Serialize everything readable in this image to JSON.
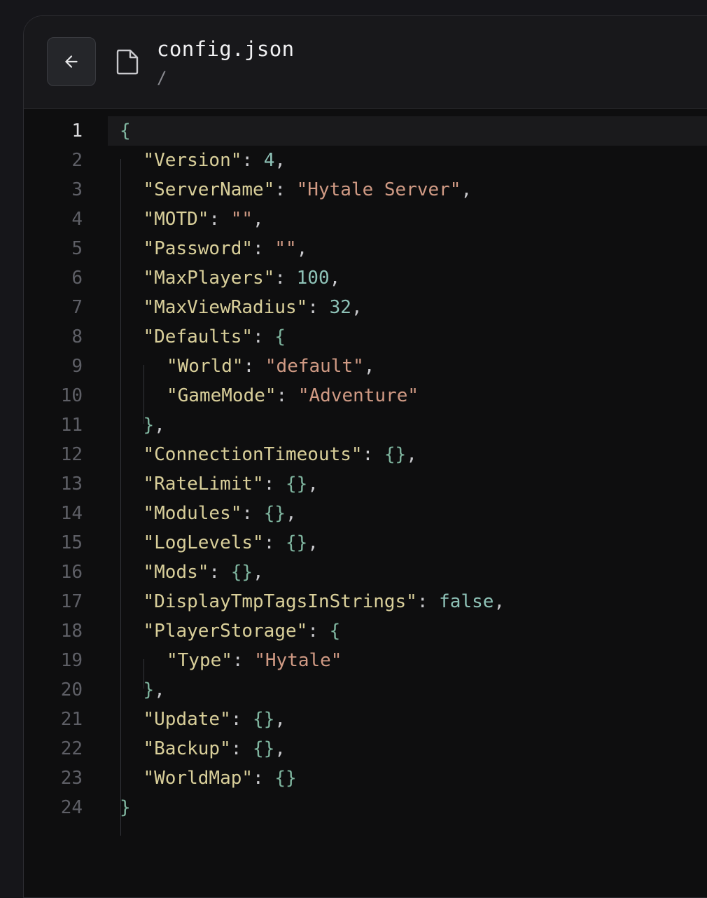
{
  "header": {
    "back_button_label": "Back",
    "file_name": "config.json",
    "file_path": "/"
  },
  "editor": {
    "current_line": 1,
    "lines": [
      {
        "n": "1",
        "tokens": [
          {
            "t": "b",
            "v": "{"
          }
        ]
      },
      {
        "n": "2",
        "tokens": [
          {
            "t": "k",
            "v": "\"Version\""
          },
          {
            "t": "p",
            "v": ": "
          },
          {
            "t": "n",
            "v": "4"
          },
          {
            "t": "p",
            "v": ","
          }
        ]
      },
      {
        "n": "3",
        "tokens": [
          {
            "t": "k",
            "v": "\"ServerName\""
          },
          {
            "t": "p",
            "v": ": "
          },
          {
            "t": "s",
            "v": "\"Hytale Server\""
          },
          {
            "t": "p",
            "v": ","
          }
        ]
      },
      {
        "n": "4",
        "tokens": [
          {
            "t": "k",
            "v": "\"MOTD\""
          },
          {
            "t": "p",
            "v": ": "
          },
          {
            "t": "s",
            "v": "\"\""
          },
          {
            "t": "p",
            "v": ","
          }
        ]
      },
      {
        "n": "5",
        "tokens": [
          {
            "t": "k",
            "v": "\"Password\""
          },
          {
            "t": "p",
            "v": ": "
          },
          {
            "t": "s",
            "v": "\"\""
          },
          {
            "t": "p",
            "v": ","
          }
        ]
      },
      {
        "n": "6",
        "tokens": [
          {
            "t": "k",
            "v": "\"MaxPlayers\""
          },
          {
            "t": "p",
            "v": ": "
          },
          {
            "t": "n",
            "v": "100"
          },
          {
            "t": "p",
            "v": ","
          }
        ]
      },
      {
        "n": "7",
        "tokens": [
          {
            "t": "k",
            "v": "\"MaxViewRadius\""
          },
          {
            "t": "p",
            "v": ": "
          },
          {
            "t": "n",
            "v": "32"
          },
          {
            "t": "p",
            "v": ","
          }
        ]
      },
      {
        "n": "8",
        "tokens": [
          {
            "t": "k",
            "v": "\"Defaults\""
          },
          {
            "t": "p",
            "v": ": "
          },
          {
            "t": "b",
            "v": "{"
          }
        ]
      },
      {
        "n": "9",
        "tokens": [
          {
            "t": "k",
            "v": "\"World\""
          },
          {
            "t": "p",
            "v": ": "
          },
          {
            "t": "s",
            "v": "\"default\""
          },
          {
            "t": "p",
            "v": ","
          }
        ]
      },
      {
        "n": "10",
        "tokens": [
          {
            "t": "k",
            "v": "\"GameMode\""
          },
          {
            "t": "p",
            "v": ": "
          },
          {
            "t": "s",
            "v": "\"Adventure\""
          }
        ]
      },
      {
        "n": "11",
        "tokens": [
          {
            "t": "b",
            "v": "}"
          },
          {
            "t": "p",
            "v": ","
          }
        ]
      },
      {
        "n": "12",
        "tokens": [
          {
            "t": "k",
            "v": "\"ConnectionTimeouts\""
          },
          {
            "t": "p",
            "v": ": "
          },
          {
            "t": "b",
            "v": "{}"
          },
          {
            "t": "p",
            "v": ","
          }
        ]
      },
      {
        "n": "13",
        "tokens": [
          {
            "t": "k",
            "v": "\"RateLimit\""
          },
          {
            "t": "p",
            "v": ": "
          },
          {
            "t": "b",
            "v": "{}"
          },
          {
            "t": "p",
            "v": ","
          }
        ]
      },
      {
        "n": "14",
        "tokens": [
          {
            "t": "k",
            "v": "\"Modules\""
          },
          {
            "t": "p",
            "v": ": "
          },
          {
            "t": "b",
            "v": "{}"
          },
          {
            "t": "p",
            "v": ","
          }
        ]
      },
      {
        "n": "15",
        "tokens": [
          {
            "t": "k",
            "v": "\"LogLevels\""
          },
          {
            "t": "p",
            "v": ": "
          },
          {
            "t": "b",
            "v": "{}"
          },
          {
            "t": "p",
            "v": ","
          }
        ]
      },
      {
        "n": "16",
        "tokens": [
          {
            "t": "k",
            "v": "\"Mods\""
          },
          {
            "t": "p",
            "v": ": "
          },
          {
            "t": "b",
            "v": "{}"
          },
          {
            "t": "p",
            "v": ","
          }
        ]
      },
      {
        "n": "17",
        "tokens": [
          {
            "t": "k",
            "v": "\"DisplayTmpTagsInStrings\""
          },
          {
            "t": "p",
            "v": ": "
          },
          {
            "t": "n",
            "v": "false"
          },
          {
            "t": "p",
            "v": ","
          }
        ]
      },
      {
        "n": "18",
        "tokens": [
          {
            "t": "k",
            "v": "\"PlayerStorage\""
          },
          {
            "t": "p",
            "v": ": "
          },
          {
            "t": "b",
            "v": "{"
          }
        ]
      },
      {
        "n": "19",
        "tokens": [
          {
            "t": "k",
            "v": "\"Type\""
          },
          {
            "t": "p",
            "v": ": "
          },
          {
            "t": "s",
            "v": "\"Hytale\""
          }
        ]
      },
      {
        "n": "20",
        "tokens": [
          {
            "t": "b",
            "v": "}"
          },
          {
            "t": "p",
            "v": ","
          }
        ]
      },
      {
        "n": "21",
        "tokens": [
          {
            "t": "k",
            "v": "\"Update\""
          },
          {
            "t": "p",
            "v": ": "
          },
          {
            "t": "b",
            "v": "{}"
          },
          {
            "t": "p",
            "v": ","
          }
        ]
      },
      {
        "n": "22",
        "tokens": [
          {
            "t": "k",
            "v": "\"Backup\""
          },
          {
            "t": "p",
            "v": ": "
          },
          {
            "t": "b",
            "v": "{}"
          },
          {
            "t": "p",
            "v": ","
          }
        ]
      },
      {
        "n": "23",
        "tokens": [
          {
            "t": "k",
            "v": "\"WorldMap\""
          },
          {
            "t": "p",
            "v": ": "
          },
          {
            "t": "b",
            "v": "{}"
          }
        ]
      },
      {
        "n": "24",
        "tokens": [
          {
            "t": "b",
            "v": "}"
          }
        ]
      }
    ]
  },
  "colors": {
    "key": "#d9cf9a",
    "string": "#d09a84",
    "number": "#8ec2b7",
    "brace": "#7fb59f",
    "line_number": "#5e5f66",
    "background": "#0e0e0f",
    "header_background": "#18181b"
  },
  "icons": {
    "back": "arrow-left-icon",
    "file": "file-icon"
  }
}
